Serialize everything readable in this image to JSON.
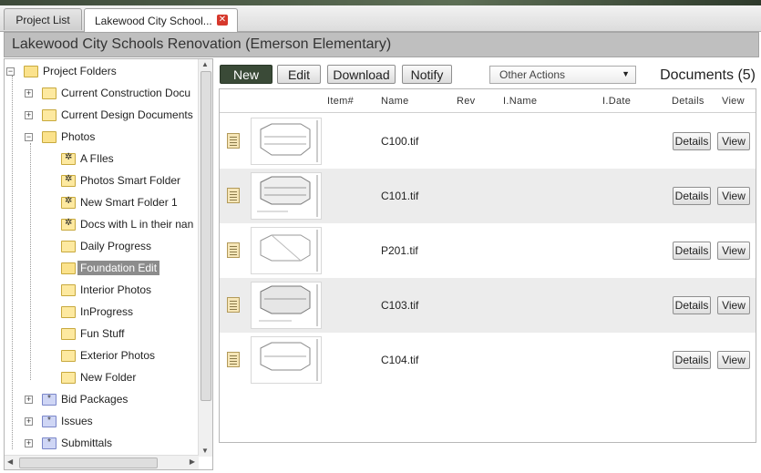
{
  "tabs": [
    {
      "label": "Project List",
      "active": false
    },
    {
      "label": "Lakewood City School...",
      "active": true
    }
  ],
  "title": "Lakewood City Schools Renovation (Emerson Elementary)",
  "tree": {
    "root": "Project Folders",
    "items": [
      {
        "label": "Current Construction Docu"
      },
      {
        "label": "Current Design Documents"
      },
      {
        "label": "Photos"
      },
      {
        "label": "A FIles"
      },
      {
        "label": "Photos Smart Folder"
      },
      {
        "label": "New Smart Folder 1"
      },
      {
        "label": "Docs with L in their nan"
      },
      {
        "label": "Daily Progress"
      },
      {
        "label": "Foundation Edit"
      },
      {
        "label": "Interior Photos"
      },
      {
        "label": "InProgress"
      },
      {
        "label": "Fun Stuff"
      },
      {
        "label": "Exterior Photos"
      },
      {
        "label": "New Folder"
      },
      {
        "label": "Bid Packages"
      },
      {
        "label": "Issues"
      },
      {
        "label": "Submittals"
      }
    ]
  },
  "toolbar": {
    "new_label": "New",
    "edit_label": "Edit",
    "download_label": "Download",
    "notify_label": "Notify",
    "other_actions": "Other Actions",
    "doc_count": "Documents (5)"
  },
  "columns": [
    "Item#",
    "Name",
    "Rev",
    "I.Name",
    "I.Date",
    "Details",
    "View"
  ],
  "rows": [
    {
      "name": "C100.tif",
      "details": "Details",
      "view": "View"
    },
    {
      "name": "C101.tif",
      "details": "Details",
      "view": "View"
    },
    {
      "name": "P201.tif",
      "details": "Details",
      "view": "View"
    },
    {
      "name": "C103.tif",
      "details": "Details",
      "view": "View"
    },
    {
      "name": "C104.tif",
      "details": "Details",
      "view": "View"
    }
  ],
  "colors": {
    "accent_dark": "#3a4a37",
    "selected": "#8c8c8c",
    "close": "#d6382c"
  }
}
